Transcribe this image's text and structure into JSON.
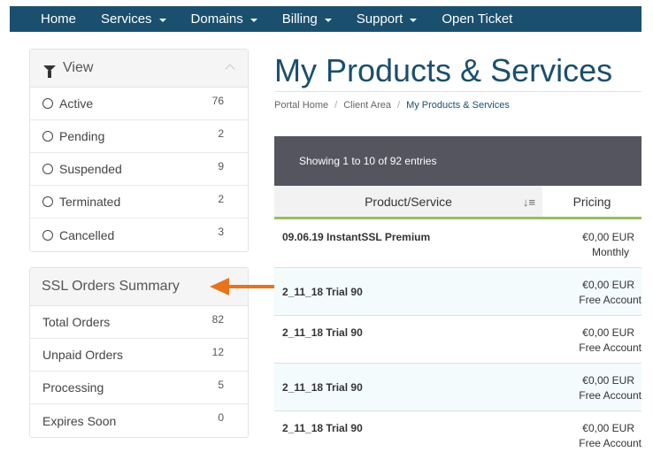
{
  "navbar": {
    "items": [
      {
        "label": "Home",
        "dropdown": false
      },
      {
        "label": "Services",
        "dropdown": true
      },
      {
        "label": "Domains",
        "dropdown": true
      },
      {
        "label": "Billing",
        "dropdown": true
      },
      {
        "label": "Support",
        "dropdown": true
      },
      {
        "label": "Open Ticket",
        "dropdown": false
      }
    ],
    "background": "#1a4f6e"
  },
  "view_panel": {
    "title": "View",
    "icon": "filter-icon",
    "items": [
      {
        "label": "Active",
        "count": "76"
      },
      {
        "label": "Pending",
        "count": "2"
      },
      {
        "label": "Suspended",
        "count": "9"
      },
      {
        "label": "Terminated",
        "count": "2"
      },
      {
        "label": "Cancelled",
        "count": "3"
      }
    ]
  },
  "ssl_panel": {
    "title": "SSL Orders Summary",
    "items": [
      {
        "label": "Total Orders",
        "count": "82"
      },
      {
        "label": "Unpaid Orders",
        "count": "12"
      },
      {
        "label": "Processing",
        "count": "5"
      },
      {
        "label": "Expires Soon",
        "count": "0"
      }
    ]
  },
  "main": {
    "title": "My Products & Services",
    "breadcrumb": [
      "Portal Home",
      "Client Area",
      "My Products & Services"
    ],
    "table_info": "Showing 1 to 10 of 92 entries",
    "columns": [
      "Product/Service",
      "Pricing"
    ],
    "rows": [
      {
        "product": "09.06.19 InstantSSL Premium",
        "amount": "€0,00 EUR",
        "cycle": "Monthly"
      },
      {
        "product": "2_11_18 Trial 90",
        "amount": "€0,00 EUR",
        "cycle": "Free Account"
      },
      {
        "product": "2_11_18 Trial 90",
        "amount": "€0,00 EUR",
        "cycle": "Free Account"
      },
      {
        "product": "2_11_18 Trial 90",
        "amount": "€0,00 EUR",
        "cycle": "Free Account"
      },
      {
        "product": "2_11_18 Trial 90",
        "amount": "€0,00 EUR",
        "cycle": "Free Account"
      }
    ],
    "accent_color": "#94c15d",
    "title_color": "#1a4f6e"
  },
  "annotation": {
    "arrow_color": "#e8731f"
  }
}
